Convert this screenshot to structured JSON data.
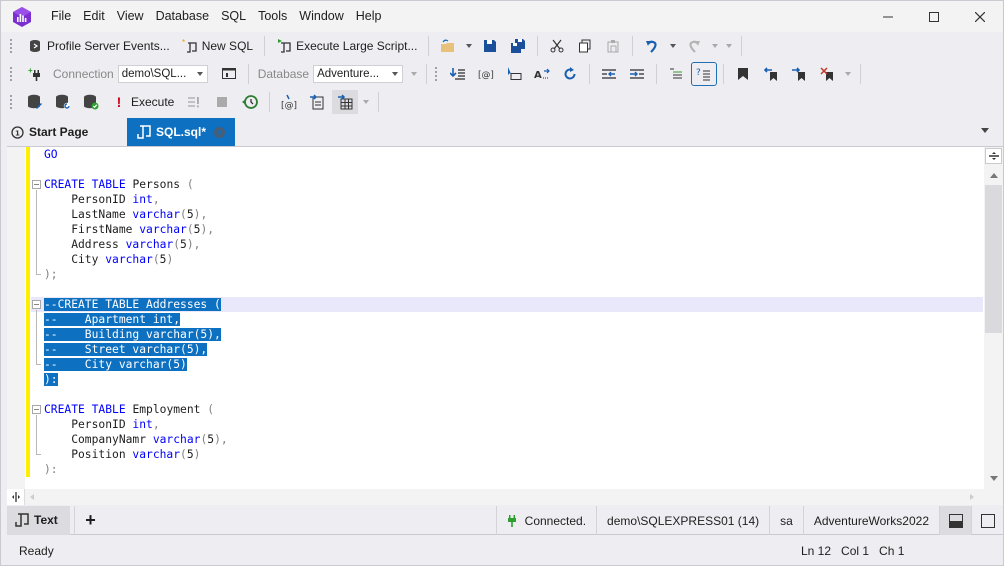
{
  "app": {
    "logo_icon": "dbforge-logo-icon",
    "menu": [
      "File",
      "Edit",
      "View",
      "Database",
      "SQL",
      "Tools",
      "Window",
      "Help"
    ],
    "window_controls": {
      "minimize": "minimize-icon",
      "maximize": "maximize-icon",
      "close": "close-icon"
    }
  },
  "toolbar1": {
    "profile_server_events": "Profile Server Events...",
    "new_sql": "New SQL",
    "execute_large_script": "Execute Large Script..."
  },
  "toolbar2": {
    "connection_label": "Connection",
    "connection_value": "demo\\SQL...",
    "database_label": "Database",
    "database_value": "Adventure..."
  },
  "toolbar3": {
    "execute_label": "Execute"
  },
  "tabs": [
    {
      "label": "Start Page",
      "icon": "start-page-icon",
      "active": false
    },
    {
      "label": "SQL.sql*",
      "icon": "sql-document-icon",
      "active": true
    }
  ],
  "editor": {
    "lines": [
      {
        "row": 0,
        "tokens": [
          [
            "kw",
            "GO"
          ]
        ]
      },
      {
        "row": 2,
        "fold": "start",
        "tokens": [
          [
            "kw",
            "CREATE"
          ],
          [
            "id",
            " "
          ],
          [
            "kw",
            "TABLE"
          ],
          [
            "id",
            " Persons "
          ],
          [
            "pn",
            "("
          ]
        ]
      },
      {
        "row": 3,
        "tokens": [
          [
            "id",
            "    PersonID "
          ],
          [
            "kw",
            "int"
          ],
          [
            "pn",
            ","
          ]
        ]
      },
      {
        "row": 4,
        "tokens": [
          [
            "id",
            "    LastName "
          ],
          [
            "kw",
            "varchar"
          ],
          [
            "pn",
            "("
          ],
          [
            "id",
            "5"
          ],
          [
            "pn",
            "),"
          ]
        ]
      },
      {
        "row": 5,
        "tokens": [
          [
            "id",
            "    FirstName "
          ],
          [
            "kw",
            "varchar"
          ],
          [
            "pn",
            "("
          ],
          [
            "id",
            "5"
          ],
          [
            "pn",
            "),"
          ]
        ]
      },
      {
        "row": 6,
        "tokens": [
          [
            "id",
            "    Address "
          ],
          [
            "kw",
            "varchar"
          ],
          [
            "pn",
            "("
          ],
          [
            "id",
            "5"
          ],
          [
            "pn",
            "),"
          ]
        ]
      },
      {
        "row": 7,
        "tokens": [
          [
            "id",
            "    City "
          ],
          [
            "kw",
            "varchar"
          ],
          [
            "pn",
            "("
          ],
          [
            "id",
            "5"
          ],
          [
            "pn",
            ")"
          ]
        ]
      },
      {
        "row": 8,
        "fold": "end",
        "tokens": [
          [
            "pn",
            ");"
          ]
        ]
      },
      {
        "row": 10,
        "fold": "start",
        "selected": true,
        "current": true,
        "tokens": [
          [
            "sel",
            "--CREATE TABLE Addresses ("
          ]
        ]
      },
      {
        "row": 11,
        "selected": true,
        "tokens": [
          [
            "sel",
            "--    Apartment int,"
          ]
        ]
      },
      {
        "row": 12,
        "selected": true,
        "tokens": [
          [
            "sel",
            "--    Building varchar(5),"
          ]
        ]
      },
      {
        "row": 13,
        "selected": true,
        "tokens": [
          [
            "sel",
            "--    Street varchar(5),"
          ]
        ]
      },
      {
        "row": 14,
        "selected": true,
        "fold": "end",
        "tokens": [
          [
            "sel",
            "--    City varchar(5)"
          ]
        ]
      },
      {
        "row": 15,
        "selected": true,
        "tokens": [
          [
            "sel",
            "):"
          ]
        ]
      },
      {
        "row": 17,
        "fold": "start",
        "tokens": [
          [
            "kw",
            "CREATE"
          ],
          [
            "id",
            " "
          ],
          [
            "kw",
            "TABLE"
          ],
          [
            "id",
            " Employment "
          ],
          [
            "pn",
            "("
          ]
        ]
      },
      {
        "row": 18,
        "tokens": [
          [
            "id",
            "    PersonID "
          ],
          [
            "kw",
            "int"
          ],
          [
            "pn",
            ","
          ]
        ]
      },
      {
        "row": 19,
        "tokens": [
          [
            "id",
            "    CompanyNamr "
          ],
          [
            "kw",
            "varchar"
          ],
          [
            "pn",
            "("
          ],
          [
            "id",
            "5"
          ],
          [
            "pn",
            "),"
          ]
        ]
      },
      {
        "row": 20,
        "fold": "end",
        "tokens": [
          [
            "id",
            "    Position "
          ],
          [
            "kw",
            "varchar"
          ],
          [
            "pn",
            "("
          ],
          [
            "id",
            "5"
          ],
          [
            "pn",
            ")"
          ]
        ]
      },
      {
        "row": 21,
        "tokens": [
          [
            "pn",
            "):"
          ]
        ]
      }
    ]
  },
  "modebar": {
    "text_label": "Text",
    "add_label": "+",
    "connection_status": "Connected.",
    "server": "demo\\SQLEXPRESS01 (14)",
    "user": "sa",
    "database": "AdventureWorks2022"
  },
  "statusbar": {
    "status": "Ready",
    "line": "Ln 12",
    "col": "Col 1",
    "ch": "Ch 1"
  },
  "colors": {
    "accent": "#0e70c0",
    "keyword": "#0000ff",
    "change_marker": "#ffee00",
    "selection": "#0e70c0"
  }
}
